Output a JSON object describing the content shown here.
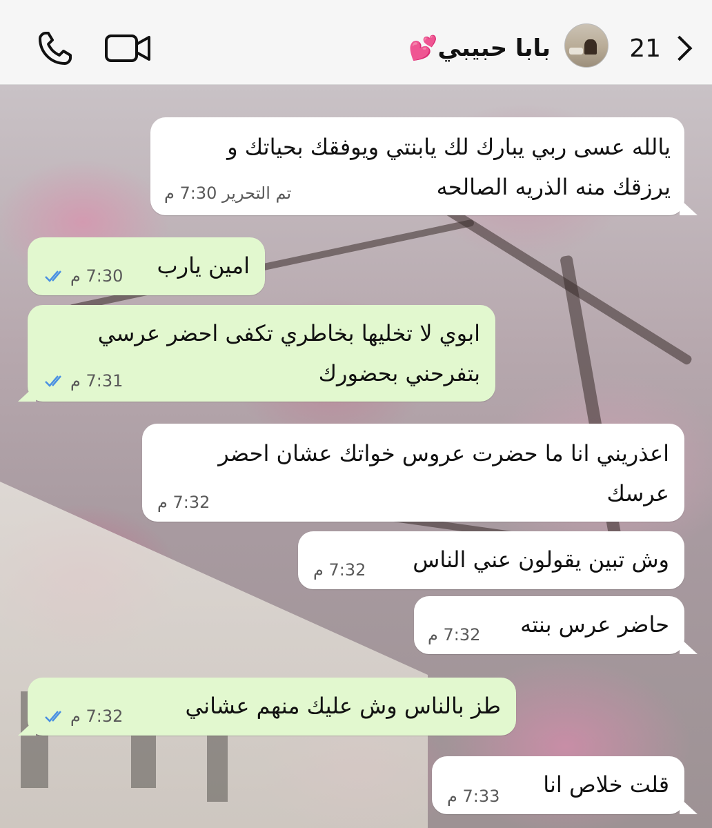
{
  "header": {
    "back_count": "21",
    "contact_name": "بابا حبيبي💕",
    "icons": [
      "chevron-back-icon",
      "avatar-photo",
      "video-call-icon",
      "phone-call-icon"
    ]
  },
  "messages": [
    {
      "direction": "incoming",
      "text": "يالله عسى ربي يبارك لك يابنتي ويوفقك بحياتك و\nيرزقك منه الذريه الصالحه",
      "meta": "تم التحرير 7:30 م"
    },
    {
      "direction": "outgoing",
      "text": "امين يارب",
      "meta": "7:30 م",
      "status": "read"
    },
    {
      "direction": "outgoing",
      "text": "ابوي لا تخليها بخاطري تكفى احضر عرسي\nبتفرحني بحضورك",
      "meta": "7:31 م",
      "status": "read"
    },
    {
      "direction": "incoming",
      "text": "اعذريني انا ما حضرت عروس خواتك عشان احضر\nعرسك",
      "meta": "7:32 م"
    },
    {
      "direction": "incoming",
      "text": "وش تبين يقولون عني الناس",
      "meta": "7:32 م"
    },
    {
      "direction": "incoming",
      "text": "حاضر عرس بنته",
      "meta": "7:32 م"
    },
    {
      "direction": "outgoing",
      "text": "طز بالناس وش عليك منهم عشاني",
      "meta": "7:32 م",
      "status": "read"
    },
    {
      "direction": "incoming",
      "text": "قلت خلاص انا",
      "meta": "7:33 م"
    }
  ],
  "colors": {
    "incoming_bubble": "#ffffff",
    "outgoing_bubble": "#e2f8cf",
    "read_ticks": "#4a90e2",
    "header_bg": "#f6f6f6"
  }
}
